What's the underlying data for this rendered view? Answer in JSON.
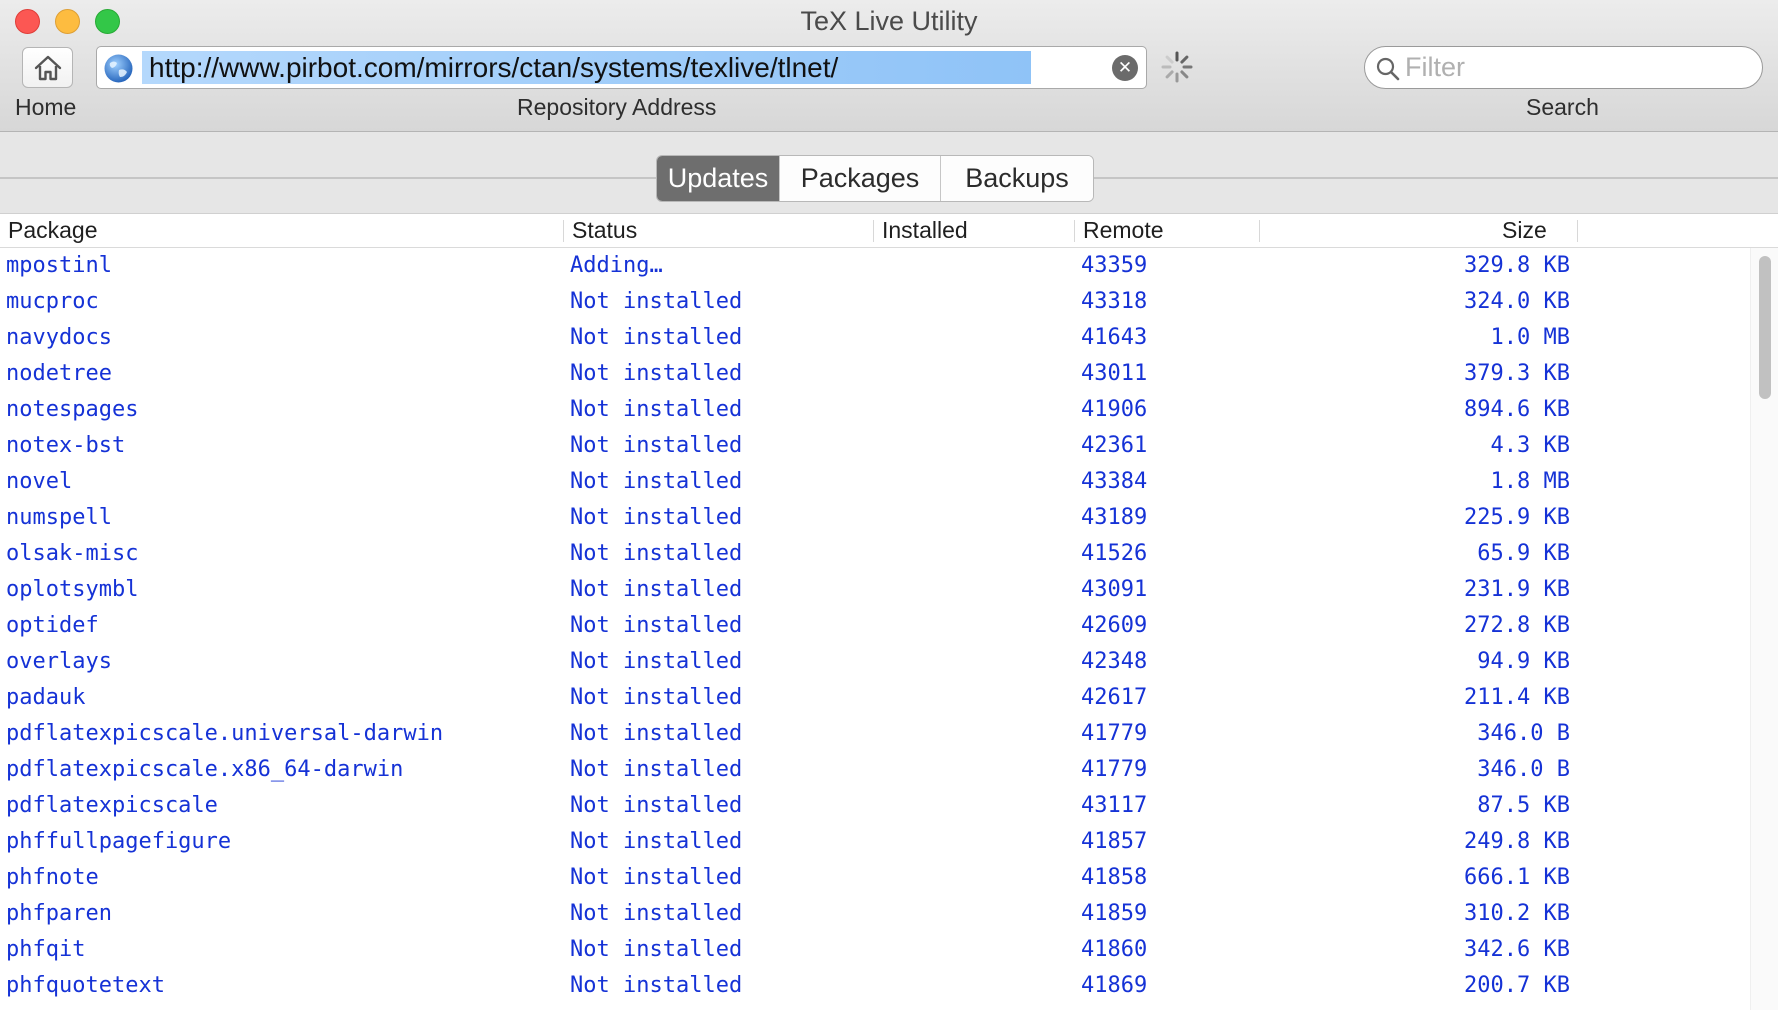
{
  "window": {
    "title": "TeX Live Utility"
  },
  "toolbar": {
    "home_label": "Home",
    "address_label": "Repository Address",
    "address_value": "http://www.pirbot.com/mirrors/ctan/systems/texlive/tlnet/",
    "search_label": "Search",
    "filter_placeholder": "Filter"
  },
  "tabs": [
    {
      "label": "Updates",
      "active": true
    },
    {
      "label": "Packages",
      "active": false
    },
    {
      "label": "Backups",
      "active": false
    }
  ],
  "table": {
    "columns": [
      "Package",
      "Status",
      "Installed",
      "Remote",
      "Size"
    ],
    "rows": [
      {
        "package": "mpostinl",
        "status": "Adding…",
        "installed": "",
        "remote": "43359",
        "size": "329.8 KB"
      },
      {
        "package": "mucproc",
        "status": "Not installed",
        "installed": "",
        "remote": "43318",
        "size": "324.0 KB"
      },
      {
        "package": "navydocs",
        "status": "Not installed",
        "installed": "",
        "remote": "41643",
        "size": "1.0 MB"
      },
      {
        "package": "nodetree",
        "status": "Not installed",
        "installed": "",
        "remote": "43011",
        "size": "379.3 KB"
      },
      {
        "package": "notespages",
        "status": "Not installed",
        "installed": "",
        "remote": "41906",
        "size": "894.6 KB"
      },
      {
        "package": "notex-bst",
        "status": "Not installed",
        "installed": "",
        "remote": "42361",
        "size": "4.3 KB"
      },
      {
        "package": "novel",
        "status": "Not installed",
        "installed": "",
        "remote": "43384",
        "size": "1.8 MB"
      },
      {
        "package": "numspell",
        "status": "Not installed",
        "installed": "",
        "remote": "43189",
        "size": "225.9 KB"
      },
      {
        "package": "olsak-misc",
        "status": "Not installed",
        "installed": "",
        "remote": "41526",
        "size": "65.9 KB"
      },
      {
        "package": "oplotsymbl",
        "status": "Not installed",
        "installed": "",
        "remote": "43091",
        "size": "231.9 KB"
      },
      {
        "package": "optidef",
        "status": "Not installed",
        "installed": "",
        "remote": "42609",
        "size": "272.8 KB"
      },
      {
        "package": "overlays",
        "status": "Not installed",
        "installed": "",
        "remote": "42348",
        "size": "94.9 KB"
      },
      {
        "package": "padauk",
        "status": "Not installed",
        "installed": "",
        "remote": "42617",
        "size": "211.4 KB"
      },
      {
        "package": "pdflatexpicscale.universal-darwin",
        "status": "Not installed",
        "installed": "",
        "remote": "41779",
        "size": "346.0 B"
      },
      {
        "package": "pdflatexpicscale.x86_64-darwin",
        "status": "Not installed",
        "installed": "",
        "remote": "41779",
        "size": "346.0 B"
      },
      {
        "package": "pdflatexpicscale",
        "status": "Not installed",
        "installed": "",
        "remote": "43117",
        "size": "87.5 KB"
      },
      {
        "package": "phffullpagefigure",
        "status": "Not installed",
        "installed": "",
        "remote": "41857",
        "size": "249.8 KB"
      },
      {
        "package": "phfnote",
        "status": "Not installed",
        "installed": "",
        "remote": "41858",
        "size": "666.1 KB"
      },
      {
        "package": "phfparen",
        "status": "Not installed",
        "installed": "",
        "remote": "41859",
        "size": "310.2 KB"
      },
      {
        "package": "phfqit",
        "status": "Not installed",
        "installed": "",
        "remote": "41860",
        "size": "342.6 KB"
      },
      {
        "package": "phfquotetext",
        "status": "Not installed",
        "installed": "",
        "remote": "41869",
        "size": "200.7 KB"
      }
    ]
  },
  "icons": {
    "home": "house-icon",
    "globe": "globe-icon",
    "clear": "clear-circle-x-icon",
    "spinner": "loading-spinner-icon",
    "search": "magnifier-icon"
  },
  "colors": {
    "link_text": "#1532d6",
    "selection": "#8fc3f7",
    "active_tab": "#6e6e6e"
  }
}
